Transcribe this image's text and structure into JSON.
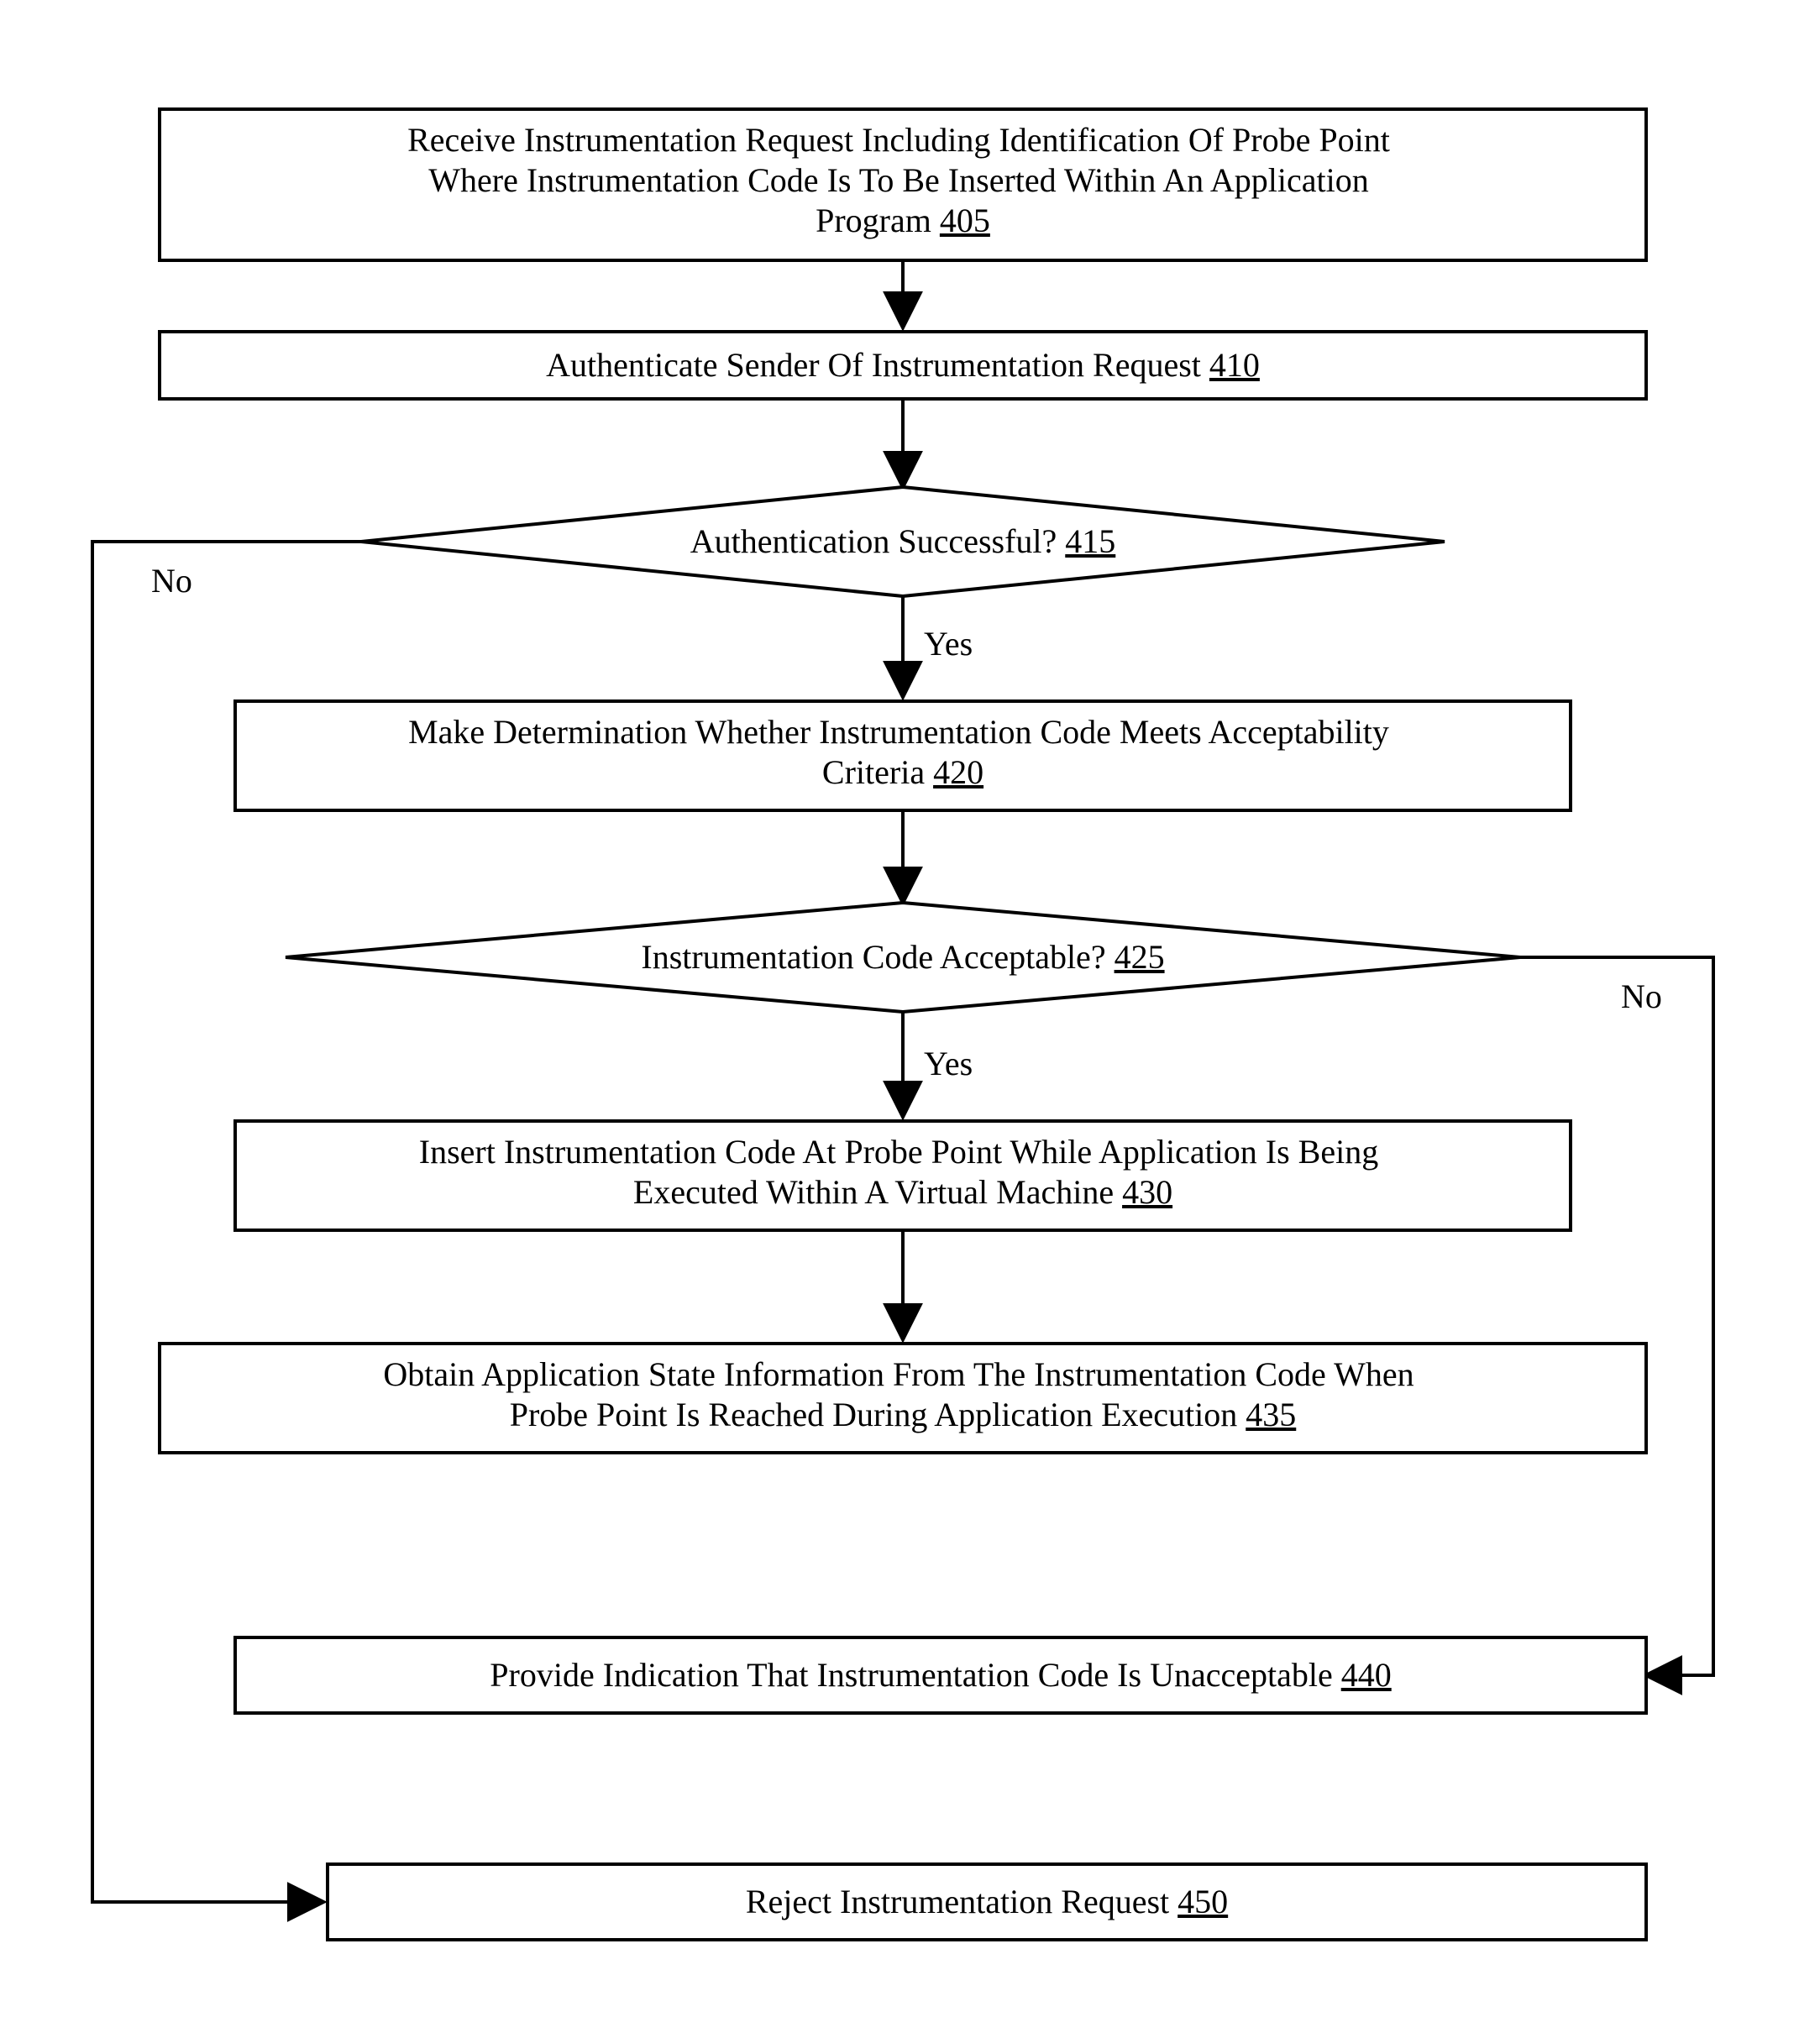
{
  "chart_data": {
    "type": "flowchart",
    "nodes": [
      {
        "id": "405",
        "shape": "rect",
        "text": "Receive Instrumentation Request Including Identification Of Probe Point Where Instrumentation Code Is To Be Inserted Within An Application Program",
        "ref": "405"
      },
      {
        "id": "410",
        "shape": "rect",
        "text": "Authenticate Sender Of Instrumentation Request",
        "ref": "410"
      },
      {
        "id": "415",
        "shape": "diamond",
        "text": "Authentication Successful?",
        "ref": "415"
      },
      {
        "id": "420",
        "shape": "rect",
        "text": "Make Determination Whether Instrumentation Code Meets Acceptability Criteria",
        "ref": "420"
      },
      {
        "id": "425",
        "shape": "diamond",
        "text": "Instrumentation Code Acceptable?",
        "ref": "425"
      },
      {
        "id": "430",
        "shape": "rect",
        "text": "Insert Instrumentation Code At Probe Point While Application Is Being Executed Within A Virtual Machine",
        "ref": "430"
      },
      {
        "id": "435",
        "shape": "rect",
        "text": "Obtain Application State Information From The Instrumentation Code When Probe Point Is Reached During Application Execution",
        "ref": "435"
      },
      {
        "id": "440",
        "shape": "rect",
        "text": "Provide Indication That Instrumentation Code Is Unacceptable",
        "ref": "440"
      },
      {
        "id": "450",
        "shape": "rect",
        "text": "Reject Instrumentation Request",
        "ref": "450"
      }
    ],
    "edges": [
      {
        "from": "405",
        "to": "410",
        "label": ""
      },
      {
        "from": "410",
        "to": "415",
        "label": ""
      },
      {
        "from": "415",
        "to": "420",
        "label": "Yes"
      },
      {
        "from": "415",
        "to": "450",
        "label": "No"
      },
      {
        "from": "420",
        "to": "425",
        "label": ""
      },
      {
        "from": "425",
        "to": "430",
        "label": "Yes"
      },
      {
        "from": "425",
        "to": "440",
        "label": "No"
      },
      {
        "from": "430",
        "to": "435",
        "label": ""
      }
    ]
  },
  "labels": {
    "yes_415": "Yes",
    "no_415": "No",
    "yes_425": "Yes",
    "no_425": "No"
  },
  "box405": {
    "l1": "Receive Instrumentation Request Including Identification Of Probe Point",
    "l2": "Where Instrumentation Code Is To Be Inserted Within An Application",
    "l3": "Program",
    "ref": "405"
  },
  "box410": {
    "l1": "Authenticate Sender Of Instrumentation Request",
    "ref": "410"
  },
  "box415": {
    "l1": "Authentication Successful?",
    "ref": "415"
  },
  "box420": {
    "l1": "Make Determination Whether Instrumentation Code Meets Acceptability",
    "l2": "Criteria",
    "ref": "420"
  },
  "box425": {
    "l1": "Instrumentation Code Acceptable?",
    "ref": "425"
  },
  "box430": {
    "l1": "Insert Instrumentation Code At Probe Point While Application Is Being",
    "l2": "Executed Within A Virtual Machine",
    "ref": "430"
  },
  "box435": {
    "l1": "Obtain Application State Information From The Instrumentation Code When",
    "l2": "Probe Point Is Reached During Application Execution",
    "ref": "435"
  },
  "box440": {
    "l1": "Provide Indication That Instrumentation Code Is Unacceptable",
    "ref": "440"
  },
  "box450": {
    "l1": "Reject Instrumentation Request",
    "ref": "450"
  }
}
